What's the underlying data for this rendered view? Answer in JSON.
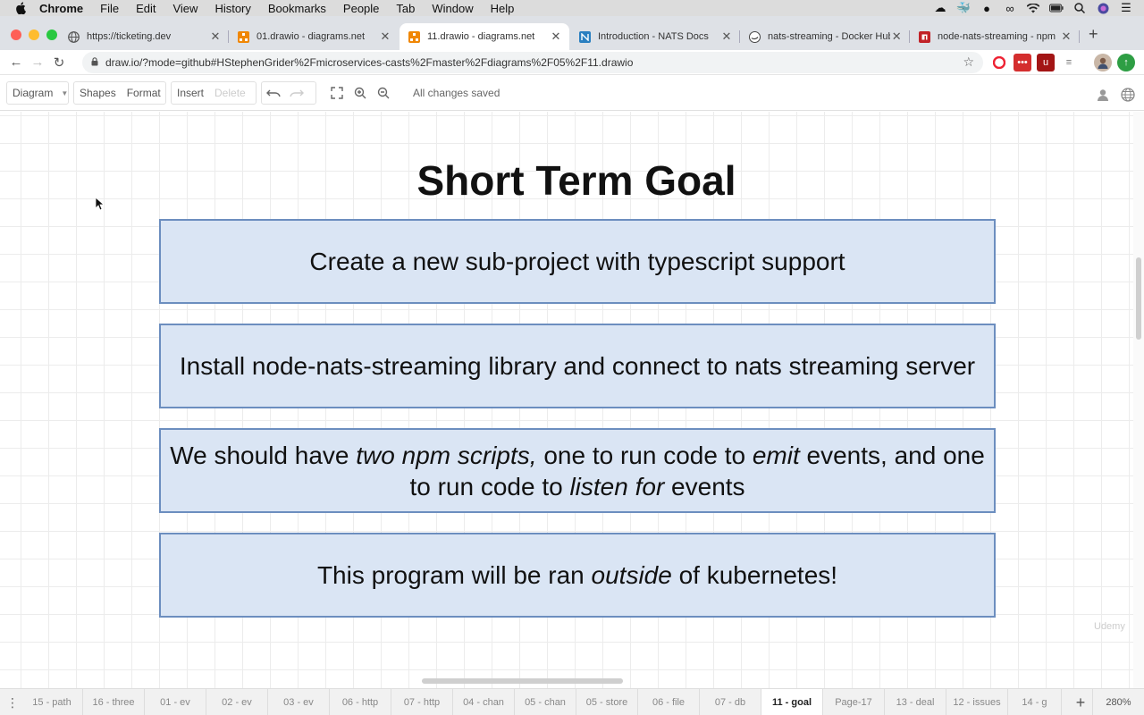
{
  "menubar": {
    "app": "Chrome",
    "items": [
      "File",
      "Edit",
      "View",
      "History",
      "Bookmarks",
      "People",
      "Tab",
      "Window",
      "Help"
    ]
  },
  "tabs": [
    {
      "title": "https://ticketing.dev",
      "icon": "globe-icon"
    },
    {
      "title": "01.drawio - diagrams.net",
      "icon": "drawio-icon"
    },
    {
      "title": "11.drawio - diagrams.net",
      "icon": "drawio-icon",
      "active": true
    },
    {
      "title": "Introduction - NATS Docs",
      "icon": "nats-icon"
    },
    {
      "title": "nats-streaming - Docker Hub",
      "icon": "docker-icon"
    },
    {
      "title": "node-nats-streaming - npm",
      "icon": "npm-icon"
    }
  ],
  "address": {
    "url": "draw.io/?mode=github#HStephenGrider%2Fmicroservices-casts%2Fmaster%2Fdiagrams%2F05%2F11.drawio"
  },
  "toolbar": {
    "diagram": "Diagram",
    "shapes": "Shapes",
    "format": "Format",
    "insert": "Insert",
    "delete": "Delete",
    "status": "All changes saved"
  },
  "canvas": {
    "title": "Short Term Goal",
    "box1": "Create a new sub-project with typescript support",
    "box2": "Install node-nats-streaming library and connect to nats streaming server",
    "box3": {
      "p1": "We should have ",
      "e1": "two npm scripts,",
      "p2": " one to run code to ",
      "e2": "emit",
      "p3": " events, and one to run code to ",
      "e3": "listen for",
      "p4": " events"
    },
    "box4": {
      "p1": "This program will be ran ",
      "e1": "outside",
      "p2": " of kubernetes!"
    },
    "watermark": "Udemy"
  },
  "pages": [
    "15 - path",
    "16 - three",
    "01 - ev",
    "02 - ev",
    "03 - ev",
    "06 - http",
    "07 - http",
    "04 - chan",
    "05 - chan",
    "05 - store",
    "06 - file",
    "07 - db",
    "11 - goal",
    "Page-17",
    "13 - deal",
    "12 - issues",
    "14 - g"
  ],
  "active_page": "11 - goal",
  "zoom": "280%",
  "colors": {
    "box_fill": "#dae5f4",
    "box_border": "#6c8ebf"
  }
}
